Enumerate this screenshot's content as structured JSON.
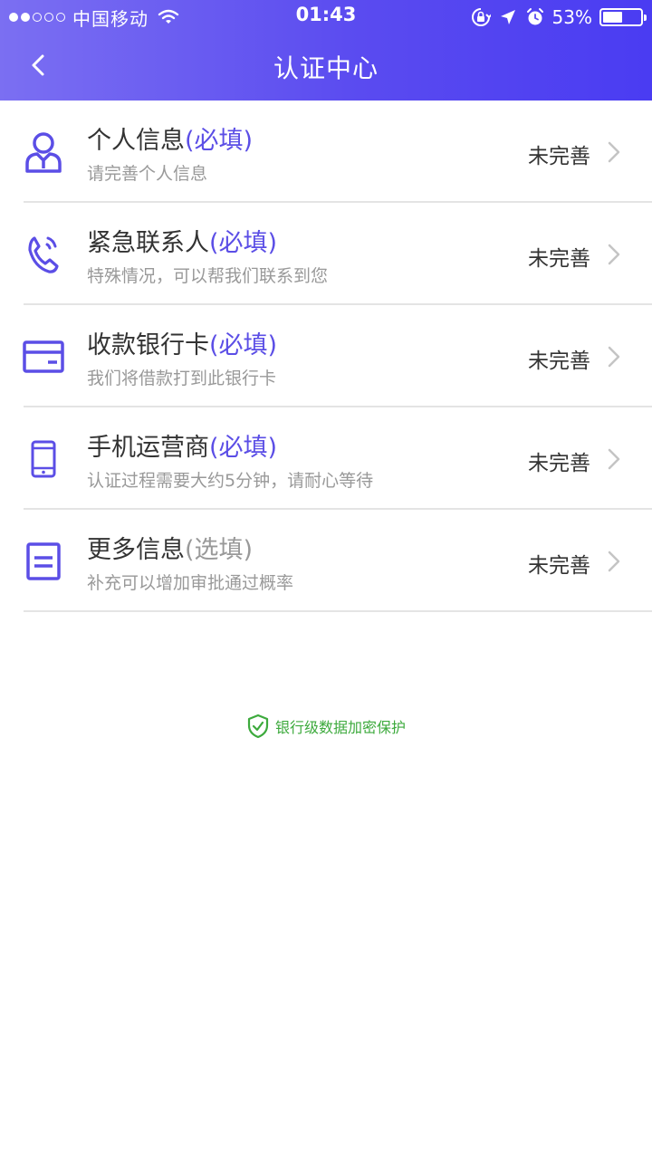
{
  "status_bar": {
    "carrier": "中国移动",
    "time": "01:43",
    "battery_percent": "53%",
    "battery_level": 0.53,
    "signal_bars_filled": 2,
    "signal_bars_total": 5,
    "icons": [
      "wifi-icon",
      "orientation-lock-icon",
      "location-arrow-icon",
      "alarm-icon",
      "battery-icon"
    ]
  },
  "navbar": {
    "title": "认证中心",
    "back_icon": "chevron-left-icon"
  },
  "colors": {
    "header_gradient_start": "#7b6ff2",
    "header_gradient_end": "#4a3cf2",
    "accent": "#5b4ee6",
    "secure_green": "#3daa3d",
    "divider": "#e4e4e4"
  },
  "items": [
    {
      "icon": "person-icon",
      "title": "个人信息",
      "tag": "(必填)",
      "required": true,
      "subtitle": "请完善个人信息",
      "status": "未完善"
    },
    {
      "icon": "phone-call-icon",
      "title": "紧急联系人",
      "tag": "(必填)",
      "required": true,
      "subtitle": "特殊情况，可以帮我们联系到您",
      "status": "未完善"
    },
    {
      "icon": "bank-card-icon",
      "title": "收款银行卡",
      "tag": "(必填)",
      "required": true,
      "subtitle": "我们将借款打到此银行卡",
      "status": "未完善"
    },
    {
      "icon": "mobile-phone-icon",
      "title": "手机运营商",
      "tag": "(必填)",
      "required": true,
      "subtitle": "认证过程需要大约5分钟，请耐心等待",
      "status": "未完善"
    },
    {
      "icon": "document-icon",
      "title": "更多信息",
      "tag": "(选填)",
      "required": false,
      "subtitle": "补充可以增加审批通过概率",
      "status": "未完善"
    }
  ],
  "footer": {
    "security_icon": "shield-check-icon",
    "security_text": "银行级数据加密保护"
  }
}
